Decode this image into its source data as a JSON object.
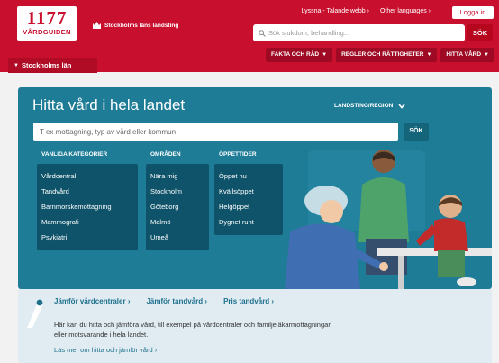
{
  "header": {
    "logo_number": "1177",
    "logo_text": "VÅRDGUIDEN",
    "county": "Stockholms läns landsting",
    "top_links": [
      "Lyssna - Talande webb",
      "Other languages"
    ],
    "login_label": "Logga in",
    "search_placeholder": "Sök sjukdom, behandling...",
    "search_button": "SÖK",
    "nav": [
      "FAKTA OCH RÅD",
      "REGLER OCH RÄTTIGHETER",
      "HITTA VÅRD"
    ],
    "region_tab": "Stockholms län",
    "colors": {
      "brand_red": "#c8102e",
      "nav_dark_red": "#9e0a24"
    }
  },
  "hero": {
    "title": "Hitta vård i hela landet",
    "region_selector": "LANDSTING/REGION",
    "search_placeholder": "T ex mottagning, typ av vård eller kommun",
    "search_button": "SÖK",
    "background_color": "#1e7c97",
    "columns": [
      {
        "heading": "VANLIGA KATEGORIER",
        "items": [
          "Vårdcentral",
          "Tandvård",
          "Barnmorskemottagning",
          "Mammografi",
          "Psykiatri"
        ]
      },
      {
        "heading": "OMRÅDEN",
        "items": [
          "Nära mig",
          "Stockholm",
          "Göteborg",
          "Malmö",
          "Umeå"
        ]
      },
      {
        "heading": "ÖPPETTIDER",
        "items": [
          "Öppet nu",
          "Kvällsöppet",
          "Helgöppet",
          "Dygnet runt"
        ]
      }
    ]
  },
  "info": {
    "links": [
      "Jämför vårdcentraler",
      "Jämför tandvård",
      "Pris tandvård"
    ],
    "text": "Här kan du hitta och jämföra vård, till exempel på vårdcentraler och familjeläkarmottagningar eller motsvarande i hela landet.",
    "more_link": "Läs mer om hitta och jämför vård"
  }
}
